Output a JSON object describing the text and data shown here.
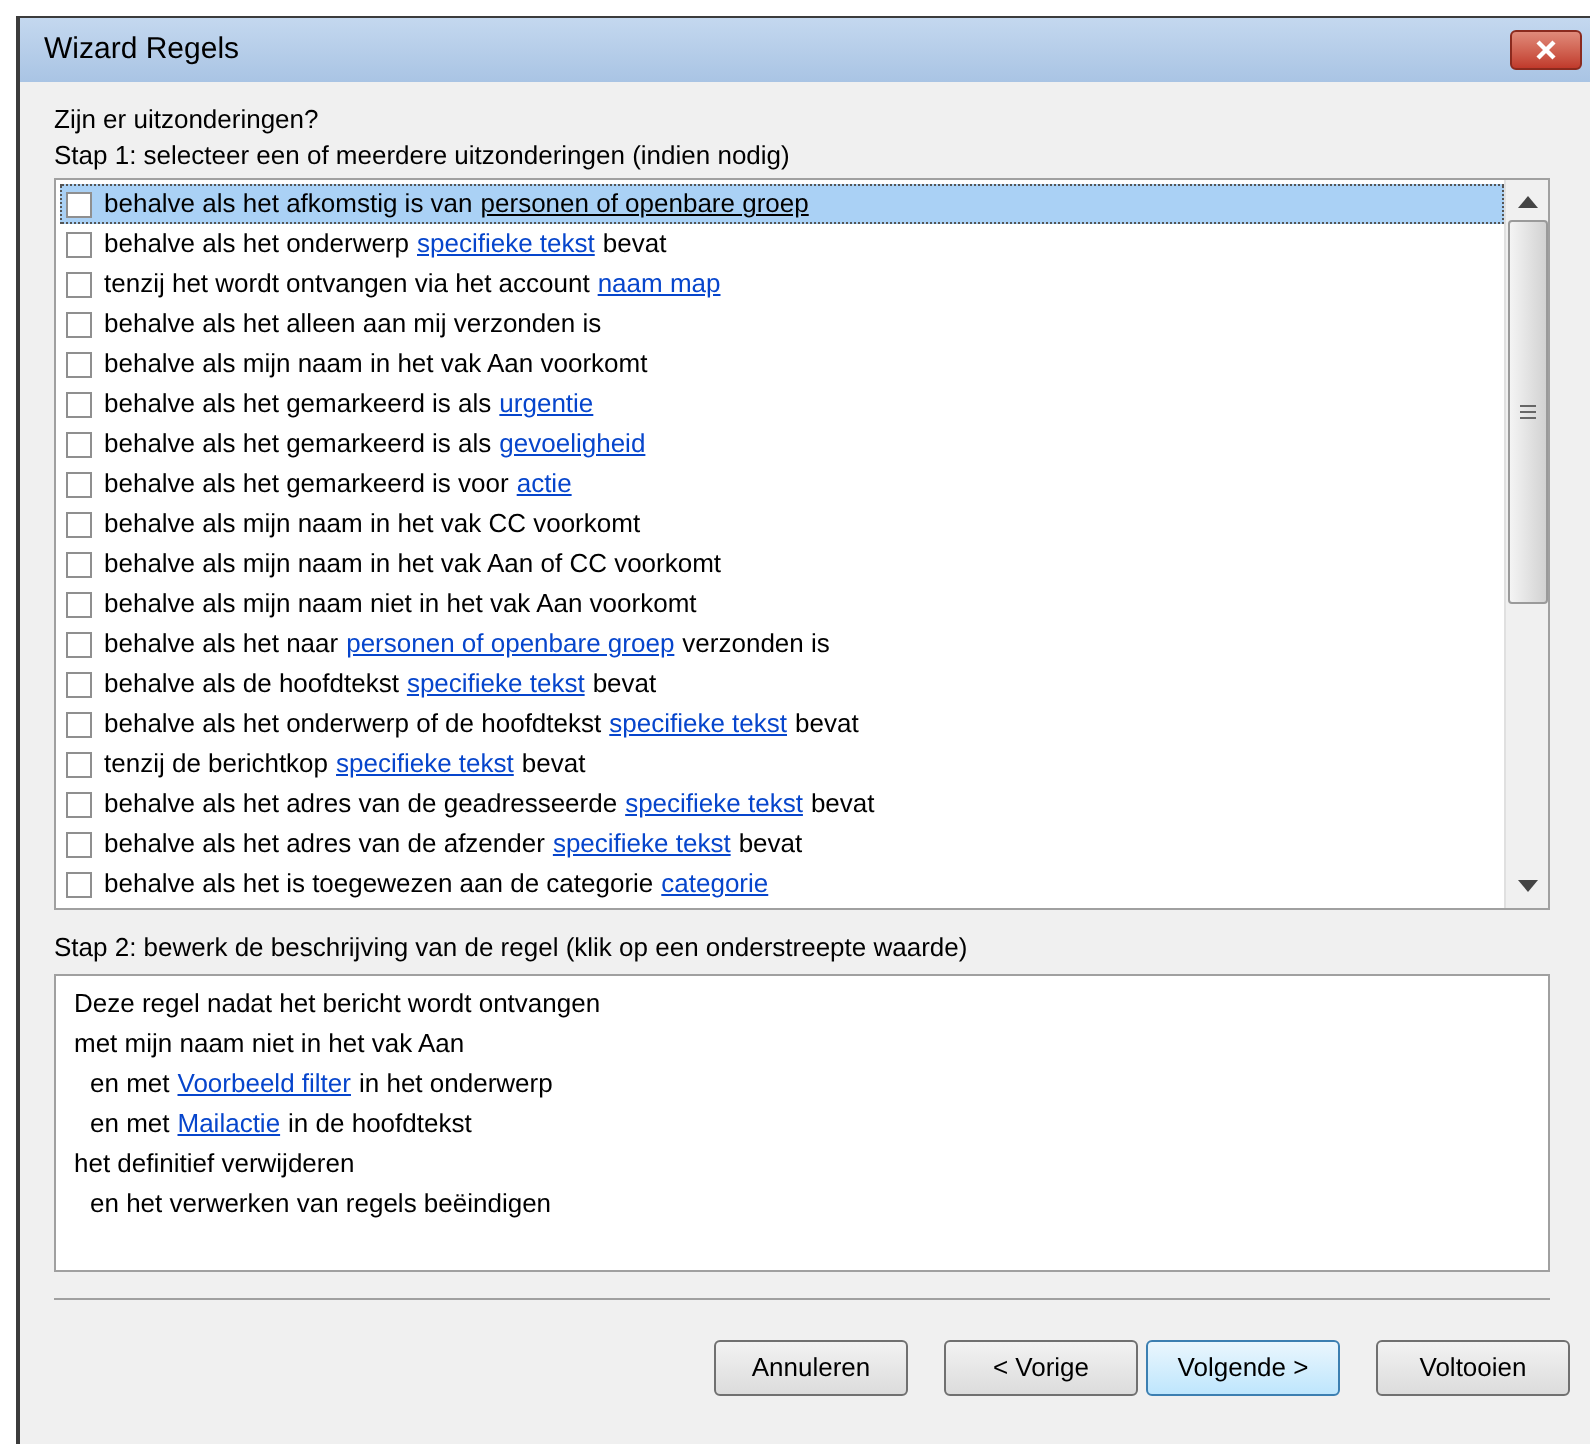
{
  "window": {
    "title": "Wizard Regels"
  },
  "question": "Zijn er uitzonderingen?",
  "step1": {
    "label": "Stap 1: selecteer een of meerdere uitzonderingen (indien nodig)",
    "items": [
      {
        "text": "behalve als het afkomstig is van",
        "link": "personen of openbare groep",
        "checked": false,
        "selected": true
      },
      {
        "text": "behalve als het onderwerp",
        "link": "specifieke tekst",
        "after": "bevat",
        "checked": false,
        "selected": false
      },
      {
        "text": "tenzij het wordt ontvangen via het account",
        "link": "naam map",
        "checked": false,
        "selected": false
      },
      {
        "text": "behalve als het alleen aan mij verzonden is",
        "checked": false,
        "selected": false
      },
      {
        "text": "behalve als mijn naam in het vak Aan voorkomt",
        "checked": false,
        "selected": false
      },
      {
        "text": "behalve als het gemarkeerd is als",
        "link": "urgentie",
        "checked": false,
        "selected": false
      },
      {
        "text": "behalve als het gemarkeerd is als",
        "link": "gevoeligheid",
        "checked": false,
        "selected": false
      },
      {
        "text": "behalve als het gemarkeerd is voor",
        "link": "actie",
        "checked": false,
        "selected": false
      },
      {
        "text": "behalve als mijn naam in het vak CC voorkomt",
        "checked": false,
        "selected": false
      },
      {
        "text": "behalve als mijn naam in het vak Aan of CC voorkomt",
        "checked": false,
        "selected": false
      },
      {
        "text": "behalve als mijn naam niet in het vak Aan voorkomt",
        "checked": false,
        "selected": false
      },
      {
        "text": "behalve als het naar",
        "link": "personen of openbare groep",
        "after": "verzonden is",
        "checked": false,
        "selected": false
      },
      {
        "text": "behalve als de hoofdtekst",
        "link": "specifieke tekst",
        "after": "bevat",
        "checked": false,
        "selected": false
      },
      {
        "text": "behalve als het onderwerp of de hoofdtekst",
        "link": "specifieke tekst",
        "after": "bevat",
        "checked": false,
        "selected": false
      },
      {
        "text": "tenzij de berichtkop",
        "link": "specifieke tekst",
        "after": "bevat",
        "checked": false,
        "selected": false
      },
      {
        "text": "behalve als het adres van de geadresseerde",
        "link": "specifieke tekst",
        "after": "bevat",
        "checked": false,
        "selected": false
      },
      {
        "text": "behalve als het adres van de afzender",
        "link": "specifieke tekst",
        "after": "bevat",
        "checked": false,
        "selected": false
      },
      {
        "text": "behalve als het is toegewezen aan de categorie",
        "link": "categorie",
        "checked": false,
        "selected": false
      }
    ]
  },
  "step2": {
    "label": "Stap 2: bewerk de beschrijving van de regel (klik op een onderstreepte waarde)",
    "lines": [
      {
        "text": "Deze regel nadat het bericht wordt ontvangen",
        "indented": false
      },
      {
        "text": "met mijn naam niet in het vak Aan",
        "indented": false
      },
      {
        "text": "en met",
        "link": "Voorbeeld filter",
        "after": "in het onderwerp",
        "indented": true
      },
      {
        "text": "en met",
        "link": "Mailactie",
        "after": "in de hoofdtekst",
        "indented": true
      },
      {
        "text": "het definitief verwijderen",
        "indented": false
      },
      {
        "text": "en het verwerken van regels beëindigen",
        "indented": true
      }
    ]
  },
  "buttons": [
    {
      "label": "Annuleren",
      "default": false
    },
    {
      "label": "< Vorige",
      "default": false
    },
    {
      "label": "Volgende >",
      "default": true
    },
    {
      "label": "Voltooien",
      "default": false
    }
  ]
}
